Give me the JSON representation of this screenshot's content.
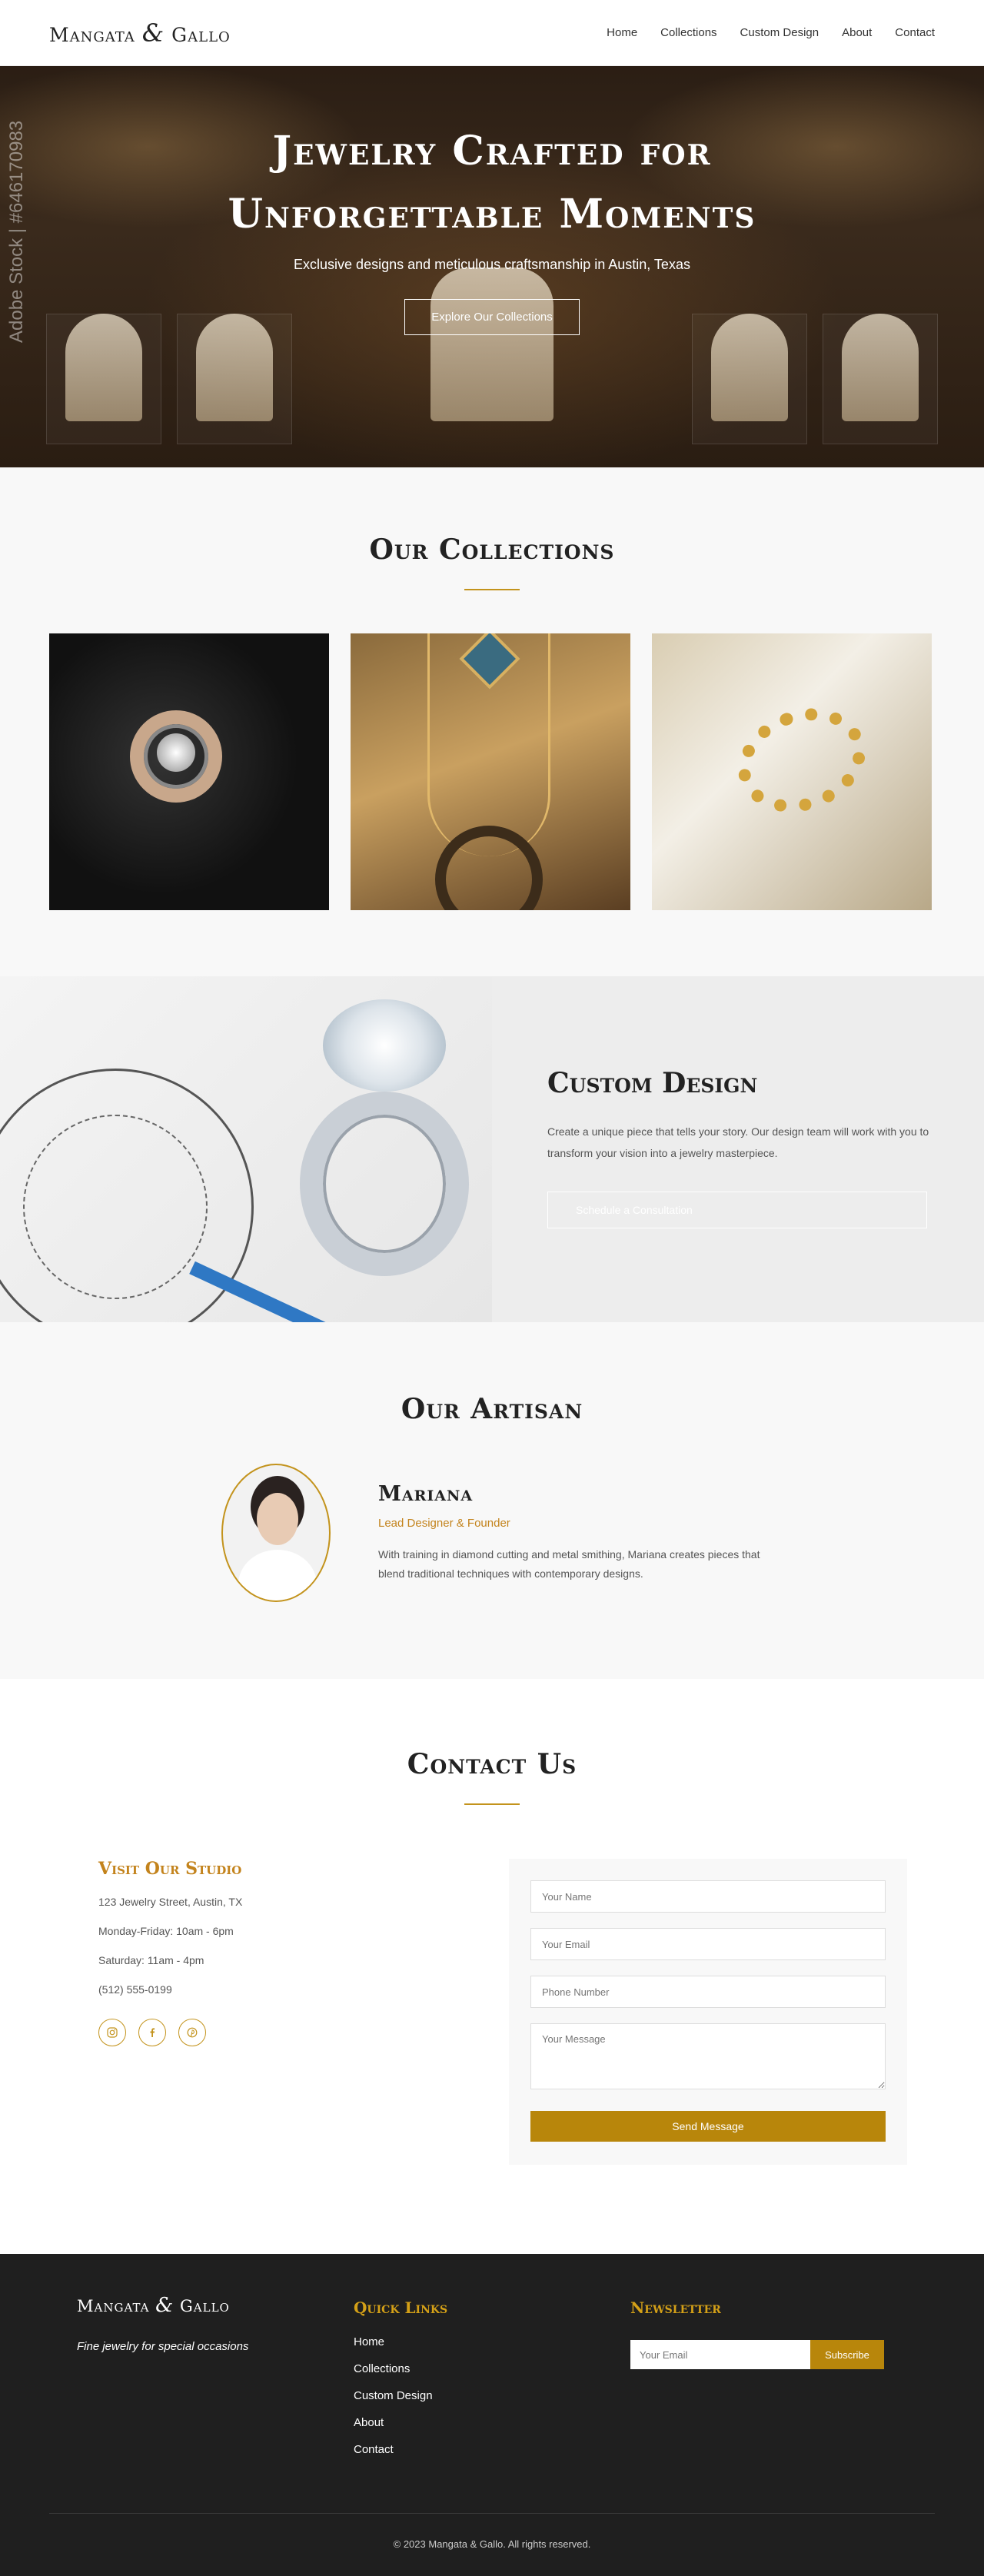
{
  "nav": {
    "logo_left": "Mangata",
    "logo_amp": "&",
    "logo_right": "Gallo",
    "links": [
      "Home",
      "Collections",
      "Custom Design",
      "About",
      "Contact"
    ]
  },
  "hero": {
    "title_line1": "Jewelry Crafted for",
    "title_line2": "Unforgettable Moments",
    "subtitle": "Exclusive designs and meticulous craftsmanship in Austin, Texas",
    "button": "Explore Our Collections",
    "watermark": "Adobe Stock | #646170983"
  },
  "collections": {
    "title": "Our Collections"
  },
  "custom": {
    "title": "Custom Design",
    "description": "Create a unique piece that tells your story. Our design team will work with you to transform your vision into a jewelry masterpiece.",
    "button": "Schedule a Consultation"
  },
  "artisan": {
    "title": "Our Artisan",
    "name": "Mariana",
    "role": "Lead Designer & Founder",
    "bio": "With training in diamond cutting and metal smithing, Mariana creates pieces that blend traditional techniques with contemporary designs."
  },
  "contact": {
    "title": "Contact Us",
    "studio_title": "Visit Our Studio",
    "address": "123 Jewelry Street, Austin, TX",
    "hours_weekday": "Monday-Friday: 10am - 6pm",
    "hours_saturday": "Saturday: 11am - 4pm",
    "phone": "(512) 555-0199",
    "form": {
      "name_placeholder": "Your Name",
      "email_placeholder": "Your Email",
      "phone_placeholder": "Phone Number",
      "message_placeholder": "Your Message",
      "submit": "Send Message"
    }
  },
  "footer": {
    "logo_left": "Mangata",
    "logo_amp": "&",
    "logo_right": "Gallo",
    "tagline": "Fine jewelry for special occasions",
    "quick_links_title": "Quick Links",
    "quick_links": [
      "Home",
      "Collections",
      "Custom Design",
      "About",
      "Contact"
    ],
    "newsletter_title": "Newsletter",
    "newsletter_placeholder": "Your Email",
    "newsletter_button": "Subscribe",
    "copyright": "© 2023 Mangata & Gallo. All rights reserved."
  },
  "colors": {
    "accent_gold": "#b8860b",
    "heading_gold": "#c3831c",
    "footer_bg": "#1f1f1f"
  },
  "icons": [
    "instagram-icon",
    "facebook-icon",
    "pinterest-icon"
  ]
}
